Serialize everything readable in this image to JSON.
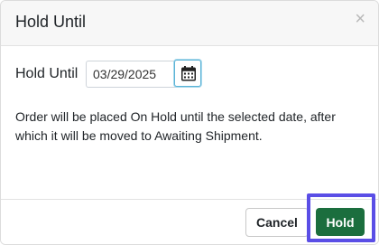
{
  "dialog": {
    "title": "Hold Until",
    "close_symbol": "×",
    "close_icon": "close-icon"
  },
  "form": {
    "label": "Hold Until",
    "date_value": "03/29/2025",
    "calendar_icon": "calendar-icon"
  },
  "description": "Order will be placed On Hold until the selected date, after which it will be moved to Awaiting Shipment.",
  "footer": {
    "cancel_label": "Cancel",
    "hold_label": "Hold"
  },
  "colors": {
    "hold_button": "#1b6e3e",
    "highlight": "#5a4ee6",
    "header_bg": "#f7f7f7"
  }
}
